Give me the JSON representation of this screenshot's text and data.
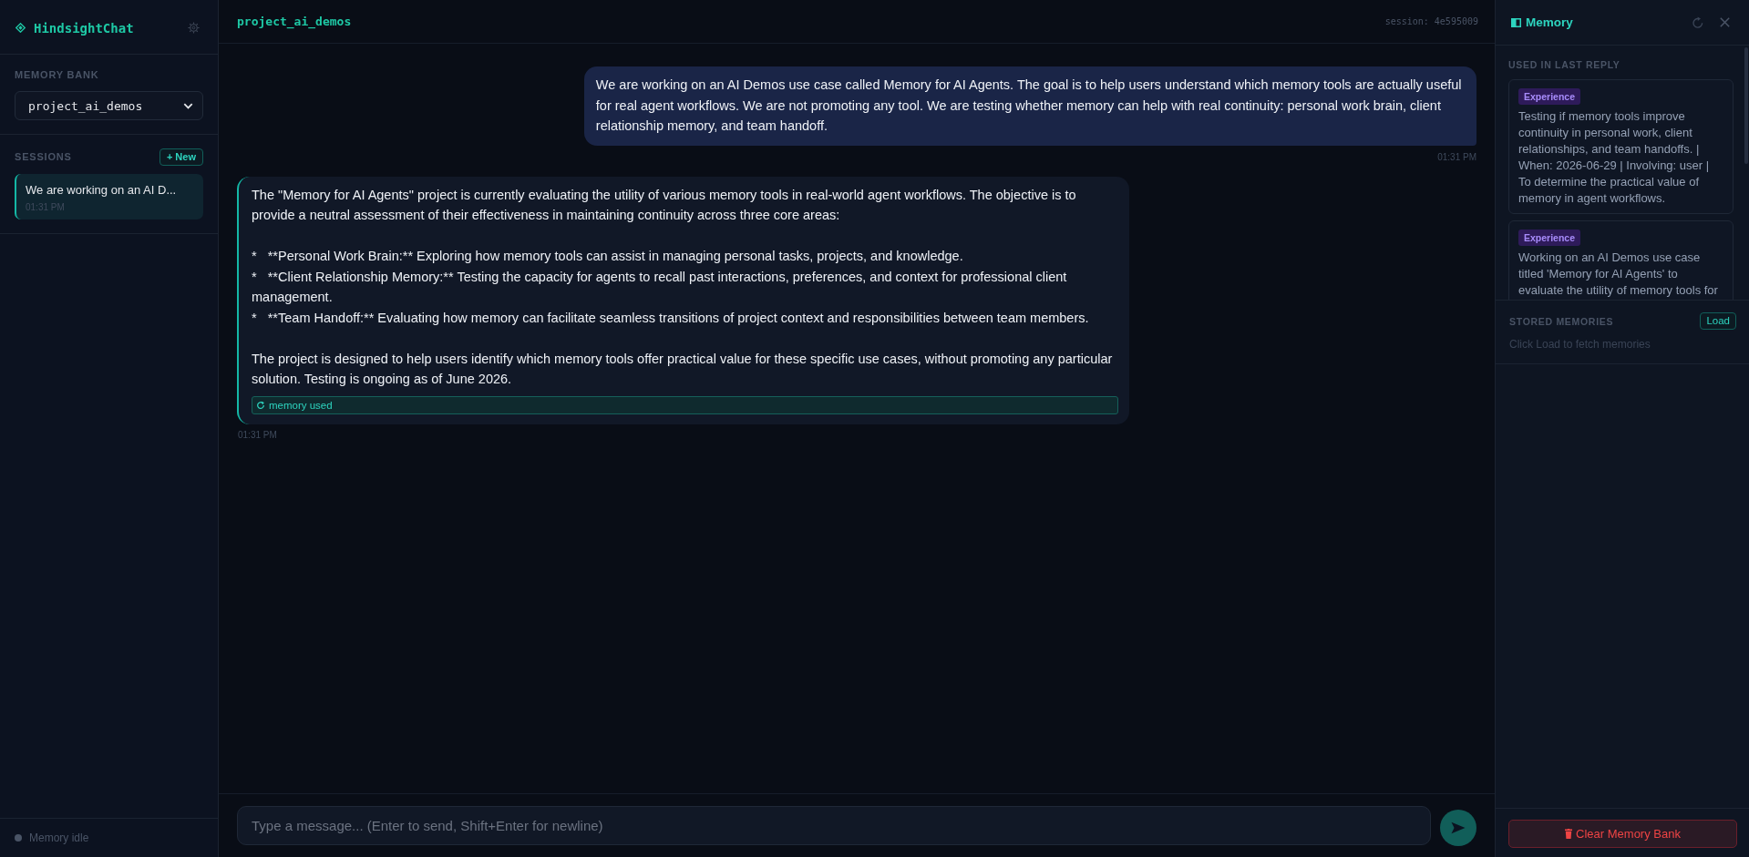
{
  "sidebar": {
    "brand": "HindsightChat",
    "memory_bank": {
      "label": "MEMORY BANK",
      "value": "project_ai_demos"
    },
    "sessions": {
      "label": "SESSIONS",
      "new_button": "+ New",
      "items": [
        {
          "title": "We are working on an AI D...",
          "time": "01:31 PM",
          "selected": true
        }
      ]
    },
    "status": {
      "text": "Memory idle",
      "active": false
    }
  },
  "chat": {
    "title": "project_ai_demos",
    "session": "session: 4e595009",
    "messages": [
      {
        "kind": "user",
        "text": "We are working on an AI Demos use case called Memory for AI Agents. The goal is to help users understand which memory tools are actually useful for real agent workflows. We are not promoting any tool. We are testing whether memory can help with real continuity: personal work brain, client relationship memory, and team handoff.",
        "time": "01:31 PM"
      },
      {
        "kind": "assistant",
        "body": [
          {
            "kind": "paragraph",
            "text": "The \"Memory for AI Agents\" project is currently evaluating the utility of various memory tools in real-world agent workflows. The objective is to provide a neutral assessment of their effectiveness in maintaining continuity across three core areas:"
          },
          {
            "kind": "bullet",
            "text": "*   **Personal Work Brain:** Exploring how memory tools can assist in managing personal tasks, projects, and knowledge."
          },
          {
            "kind": "bullet",
            "text": "*   **Client Relationship Memory:** Testing the capacity for agents to recall past interactions, preferences, and context for professional client management."
          },
          {
            "kind": "bullet",
            "text": "*   **Team Handoff:** Evaluating how memory can facilitate seamless transitions of project context and responsibilities between team members."
          },
          {
            "kind": "paragraph",
            "text": "The project is designed to help users identify which memory tools offer practical value for these specific use cases, without promoting any particular solution. Testing is ongoing as of June 2026."
          }
        ],
        "memory_button": "memory used",
        "time": "01:31 PM"
      }
    ],
    "input": {
      "placeholder": "Type a message... (Enter to send, Shift+Enter for newline)"
    }
  },
  "memory": {
    "title": "Memory",
    "used": {
      "label": "USED IN LAST REPLY",
      "items": [
        {
          "tag": "Experience",
          "text": "Testing if memory tools improve continuity in personal work, client relationships, and team handoffs. | When: 2026-06-29 | Involving: user | To determine the practical value of memory in agent workflows."
        },
        {
          "tag": "Experience",
          "text": "Working on an AI Demos use case titled 'Memory for AI Agents' to evaluate the utility of memory tools for"
        }
      ]
    },
    "stored": {
      "label": "STORED MEMORIES",
      "button": "Load",
      "empty": "Click Load to fetch memories"
    },
    "clear_button": "Clear Memory Bank"
  }
}
